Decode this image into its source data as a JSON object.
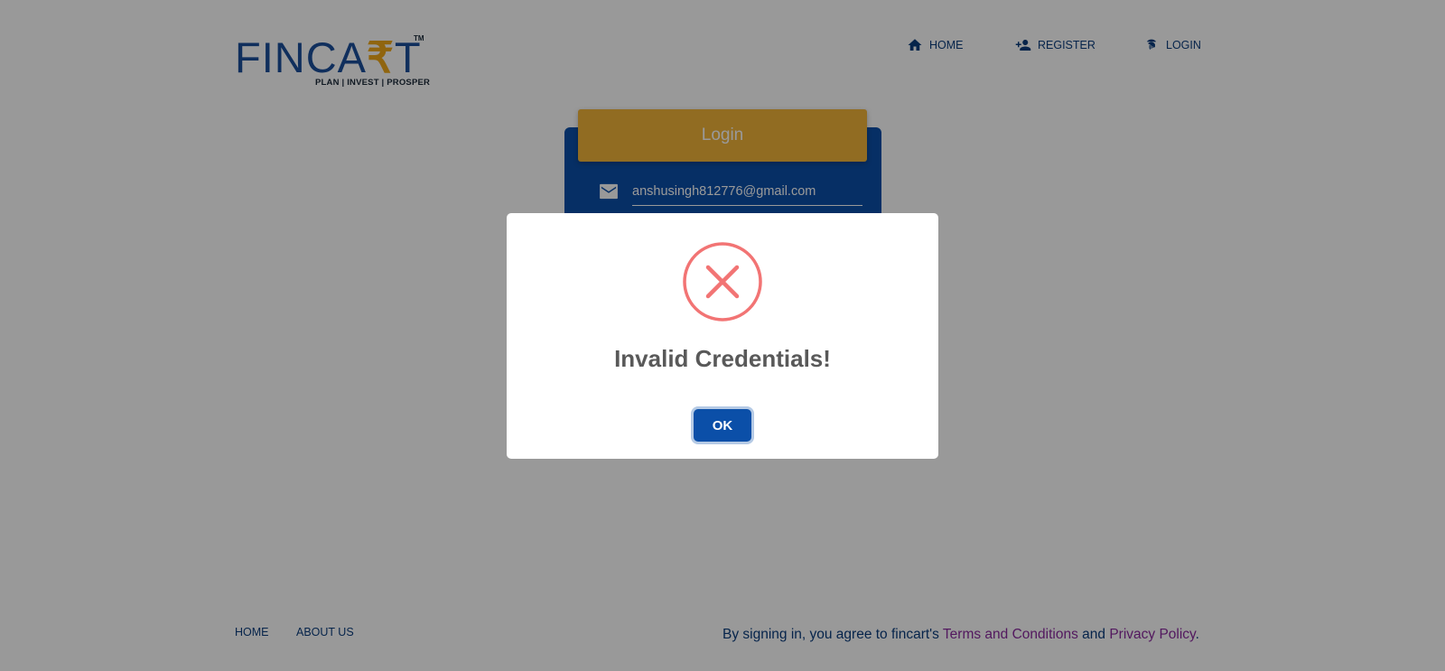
{
  "header": {
    "logo": {
      "word_prefix": "FINCA",
      "word_rupee": "₹",
      "word_suffix": "T",
      "tm": "TM",
      "tagline": "PLAN | INVEST | PROSPER"
    },
    "nav": [
      {
        "label": "HOME",
        "icon": "home-icon"
      },
      {
        "label": "REGISTER",
        "icon": "add-person-icon"
      },
      {
        "label": "LOGIN",
        "icon": "fingerprint-icon"
      }
    ]
  },
  "login_card": {
    "title": "Login",
    "email_value": "anshusingh812776@gmail.com",
    "email_icon": "mail-icon"
  },
  "footer": {
    "links": [
      "HOME",
      "ABOUT US"
    ],
    "legal": {
      "prefix": "By signing in, you agree to fincart's ",
      "terms": "Terms and Conditions",
      "and": " and ",
      "privacy": "Privacy Policy",
      "suffix": "."
    }
  },
  "dialog": {
    "icon": "error-x-icon",
    "title": "Invalid Credentials!",
    "ok_label": "OK"
  },
  "colors": {
    "brand_blue": "#0b4fa8",
    "header_gold": "#f2b43a",
    "error_red": "#f27474",
    "link_purple": "#8a2a9e"
  }
}
